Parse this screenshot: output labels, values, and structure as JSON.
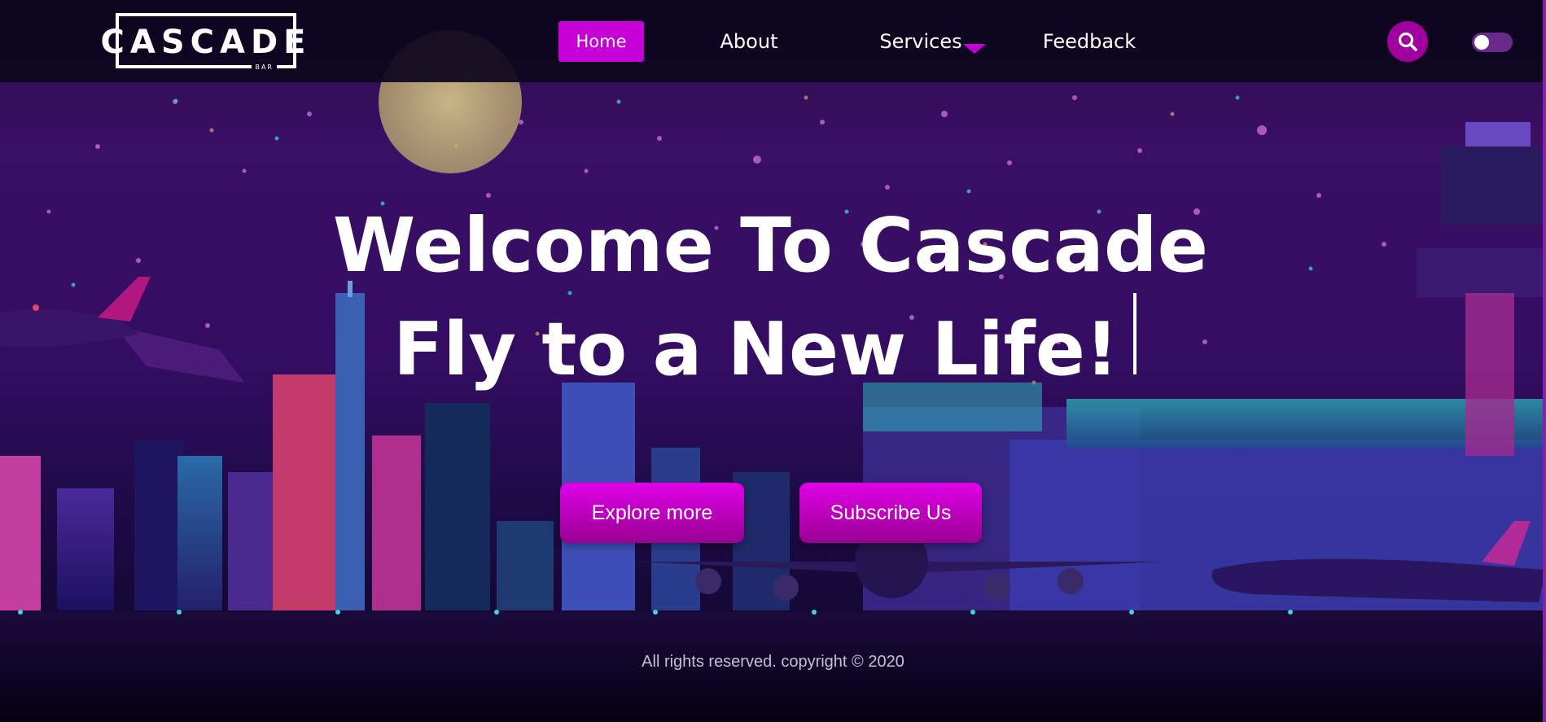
{
  "header": {
    "logo": {
      "text": "CASCADE",
      "subtext": "BAR"
    },
    "nav": {
      "home": "Home",
      "about": "About",
      "services": "Services",
      "feedback": "Feedback"
    },
    "icons": {
      "search": "search-icon",
      "services_dropdown": "caret-down-icon"
    },
    "theme_toggle": {
      "state": "off"
    }
  },
  "hero": {
    "title_line1": "Welcome To Cascade",
    "title_line2": "Fly to a New Life!",
    "buttons": {
      "explore": "Explore more",
      "subscribe": "Subscribe Us"
    }
  },
  "footer": {
    "copyright": "All rights reserved. copyright © 2020"
  },
  "colors": {
    "accent": "#c800d8",
    "navbar_bg": "#0c051c",
    "sky": "#3a0f66"
  }
}
